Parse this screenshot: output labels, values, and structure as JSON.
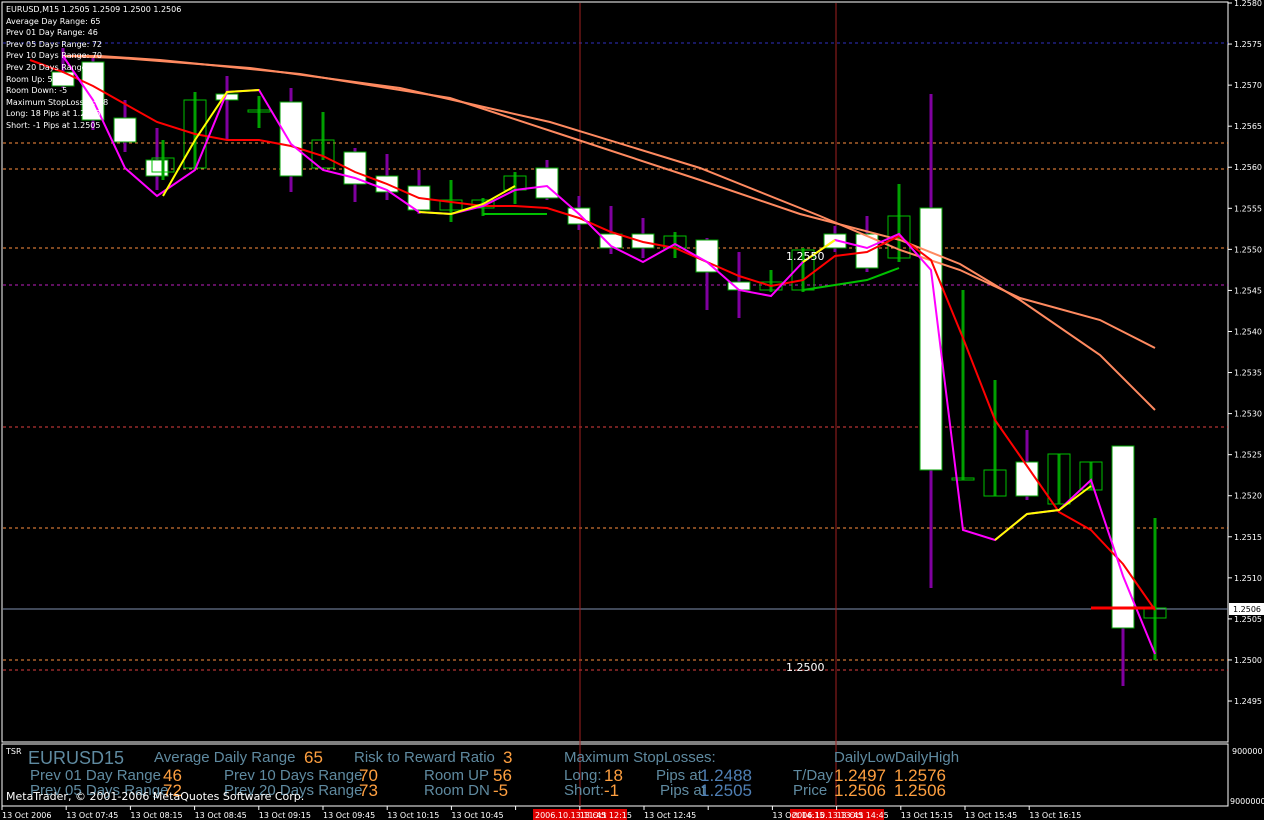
{
  "window": {
    "header_lines": [
      "EURUSD,M15  1.2505 1.2509 1.2500 1.2506",
      "Average Day  Range: 65",
      "Prev 01  Day  Range: 46",
      "Prev 05  Days Range: 72",
      "Prev 10  Days Range: 70",
      "Prev 20  Days Range: 73",
      "Room Up: 56",
      "Room Down: -5",
      "Maximum StopLosses: 18",
      "Long:  18 Pips at 1.2488",
      "Short: -1 Pips at 1.2505"
    ],
    "copyright": "MetaTrader, © 2001-2006 MetaQuotes Software Corp."
  },
  "price_axis": {
    "labels": [
      "1.2580",
      "1.2575",
      "1.2570",
      "1.2565",
      "1.2560",
      "1.2555",
      "1.2550",
      "1.2545",
      "1.2540",
      "1.2535",
      "1.2530",
      "1.2525",
      "1.2520",
      "1.2515",
      "1.2510",
      "1.2505",
      "1.2500",
      "1.2495"
    ],
    "current_price": "1.2506",
    "indicator_top": "900000",
    "indicator_bottom": "9000000"
  },
  "time_axis": {
    "labels": [
      "13 Oct 2006",
      "13 Oct 07:45",
      "13 Oct 08:15",
      "13 Oct 08:45",
      "13 Oct 09:15",
      "13 Oct 09:45",
      "13 Oct 10:15",
      "13 Oct 10:45",
      "2006.10.13 11:45",
      "13 Oct 12:15",
      "13 Oct 12:45",
      "2006.10.13 13:45",
      "13 Oct 14:15",
      "13 Oct 14:45",
      "13 Oct 15:15",
      "13 Oct 15:45",
      "13 Oct 16:15"
    ],
    "highlighted": [
      "2006.10.13 11:45",
      "2006.10.13 13:45"
    ]
  },
  "chart_labels": {
    "level_1": "1.2550",
    "level_2": "1.2500"
  },
  "indicator_panel": {
    "tag": "TSR",
    "symbol": "EURUSD15",
    "avg_daily_range_label": "Average Daily Range",
    "avg_daily_range_value": "65",
    "risk_reward_label": "Risk to Reward Ratio",
    "risk_reward_value": "3",
    "max_stoploss_label": "Maximum StopLosses:",
    "daily_low_high_label": "DailyLowDailyHigh",
    "prev01_label": "Prev 01 Day Range",
    "prev01_value": "46",
    "prev05_label": "Prev 05 Days Range",
    "prev05_value": "72",
    "prev10_label": "Prev 10 Days Range",
    "prev10_value": "70",
    "prev20_label": "Prev 20 Days Range",
    "prev20_value": "73",
    "room_up_label": "Room UP",
    "room_up_value": "56",
    "room_dn_label": "Room DN",
    "room_dn_value": "-5",
    "long_label": "Long:",
    "long_value": "18",
    "short_label": "Short:",
    "short_value": "-1",
    "pips_at_label": "Pips at",
    "long_price": "1.2488",
    "short_price": "1.2505",
    "tday_label": "T/Day",
    "price_label": "Price",
    "tday_low": "1.2497",
    "tday_high": "1.2576",
    "price_low": "1.2506",
    "price_high": "1.2506"
  },
  "colors": {
    "bull_candle": "#ffffff",
    "bear_candle": "#00c000",
    "wick_up": "#00c000",
    "wick_down": "#800080",
    "ma_fast": "#ff0000",
    "ma_slow1": "#ff8060",
    "ma_slow2": "#ff9070",
    "zigzag": "#ff00ff",
    "panel_label": "#5f8aa0",
    "panel_value": "#ffa040"
  }
}
